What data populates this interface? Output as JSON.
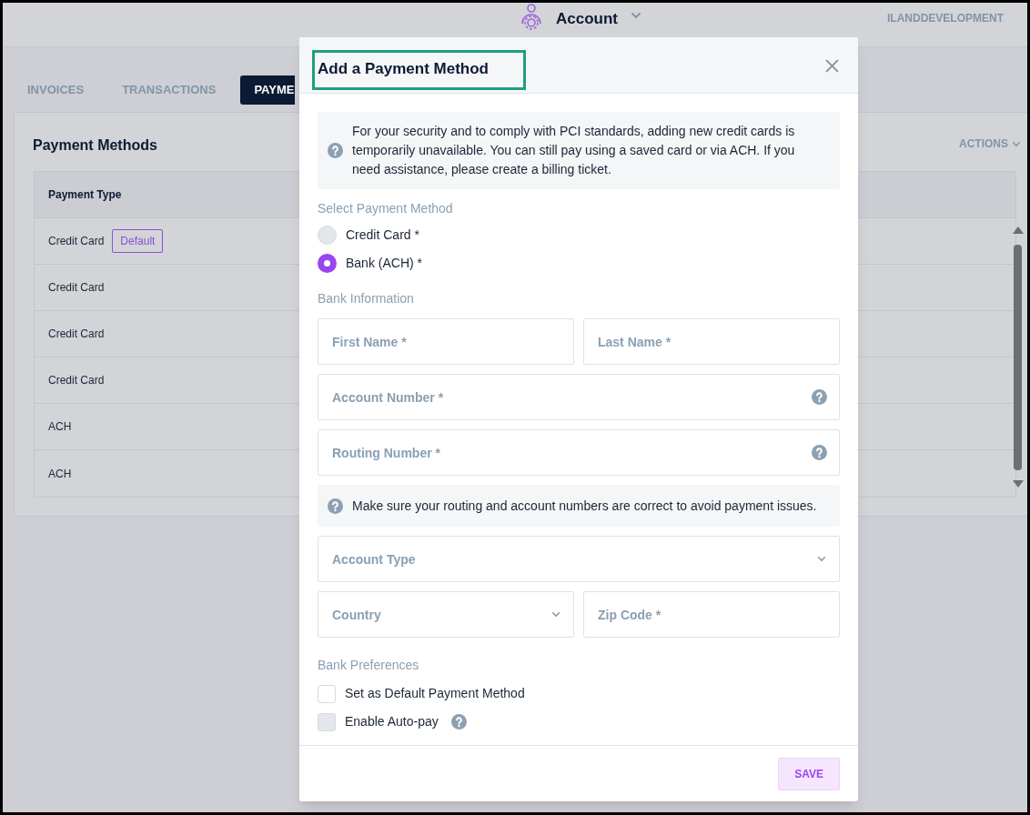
{
  "header": {
    "title": "Account",
    "org": "ILANDDEVELOPMENT"
  },
  "tabs": [
    {
      "label": "INVOICES",
      "selected": false
    },
    {
      "label": "TRANSACTIONS",
      "selected": false
    },
    {
      "label": "PAYME",
      "selected": true
    }
  ],
  "card": {
    "title": "Payment Methods",
    "actions": "ACTIONS"
  },
  "table": {
    "columns": [
      "Payment Type"
    ],
    "rows": [
      {
        "type": "Credit Card",
        "badge": "Default"
      },
      {
        "type": "Credit Card"
      },
      {
        "type": "Credit Card"
      },
      {
        "type": "Credit Card"
      },
      {
        "type": "ACH"
      },
      {
        "type": "ACH"
      }
    ]
  },
  "modal": {
    "title": "Add a Payment Method",
    "notice": "For your security and to comply with PCI standards, adding new credit cards is temporarily unavailable. You can still pay using a saved card or via ACH. If you need assistance, please create a billing ticket.",
    "method_label": "Select Payment Method",
    "methods": [
      {
        "label": "Credit Card *",
        "selected": false
      },
      {
        "label": "Bank (ACH) *",
        "selected": true
      }
    ],
    "bank_label": "Bank Information",
    "fields": [
      [
        {
          "kind": "text",
          "placeholder": "First Name *"
        },
        {
          "kind": "text",
          "placeholder": "Last Name *"
        }
      ],
      [
        {
          "kind": "text",
          "placeholder": "Account Number *",
          "help": true
        }
      ],
      [
        {
          "kind": "text",
          "placeholder": "Routing Number *",
          "help": true
        }
      ],
      [
        {
          "kind": "note",
          "text": "Make sure your routing and account numbers are correct to avoid payment issues."
        }
      ],
      [
        {
          "kind": "select",
          "placeholder": "Account Type"
        }
      ],
      [
        {
          "kind": "select",
          "placeholder": "Country"
        },
        {
          "kind": "text",
          "placeholder": "Zip Code *"
        }
      ]
    ],
    "prefs_label": "Bank Preferences",
    "prefs": [
      {
        "label": "Set as Default Payment Method",
        "checked": false,
        "disabled": false,
        "help": false
      },
      {
        "label": "Enable Auto-pay",
        "checked": false,
        "disabled": true,
        "help": true
      }
    ],
    "save": "SAVE"
  }
}
